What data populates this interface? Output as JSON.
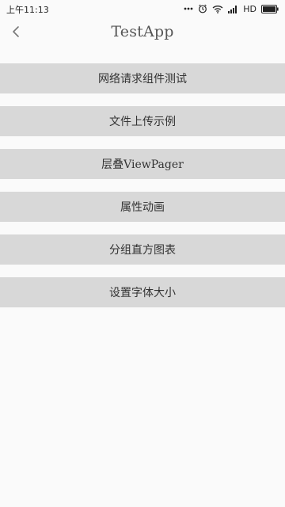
{
  "status_bar": {
    "time": "上午11:13",
    "network": "HD",
    "icons": [
      "more-dots-icon",
      "alarm-icon",
      "wifi-icon",
      "signal-icon",
      "battery-icon"
    ]
  },
  "toolbar": {
    "title": "TestApp",
    "back_icon": "chevron-left-icon"
  },
  "menu": {
    "items": [
      {
        "label": "网络请求组件测试"
      },
      {
        "label": "文件上传示例"
      },
      {
        "label": "层叠ViewPager"
      },
      {
        "label": "属性动画"
      },
      {
        "label": "分组直方图表"
      },
      {
        "label": "设置字体大小"
      }
    ]
  },
  "colors": {
    "background": "#fafafa",
    "item_background": "#d8d8d8",
    "text": "#333333"
  }
}
